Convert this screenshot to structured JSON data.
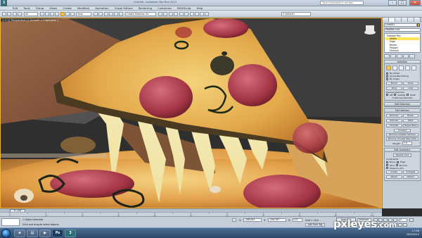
{
  "window": {
    "title": "Untitled - Autodesk 3ds Max 2012",
    "search_placeholder": "Type a keyword or phrase",
    "minimize": "–",
    "maximize": "□",
    "close": "✕"
  },
  "menu": [
    "Edit",
    "Tools",
    "Group",
    "Views",
    "Create",
    "Modifiers",
    "Animation",
    "Graph Editors",
    "Rendering",
    "Customize",
    "MAXScript",
    "Help"
  ],
  "toolbar": {
    "filter_value": "All",
    "refcoord_value": "View",
    "named_sel_placeholder": "Create Selection Se",
    "layer_value": "0 (default)"
  },
  "viewport": {
    "label": "[ + ] [ Perspective ] [ Smooth + Highlights ]"
  },
  "command_panel": {
    "object_name": "Line001",
    "modifier_list": "Modifier List",
    "stack": [
      {
        "label": "Editable Poly",
        "selected": false,
        "sub": false
      },
      {
        "label": "Vertex",
        "selected": true,
        "sub": true
      },
      {
        "label": "Edge",
        "selected": false,
        "sub": true
      },
      {
        "label": "Border",
        "selected": false,
        "sub": true
      },
      {
        "label": "Polygon",
        "selected": false,
        "sub": true
      },
      {
        "label": "Element",
        "selected": false,
        "sub": true
      }
    ],
    "selection_rollout": {
      "title": "Selection",
      "by_vertex": "By Vertex",
      "ignore_backfacing": "Ignore Backfacing",
      "by_angle": "By Angle:",
      "shrink": "Shrink",
      "grow": "Grow",
      "ring": "Ring",
      "loop": "Loop",
      "preview_selection": "Preview Selection",
      "off": "Off",
      "subobj": "SubObj",
      "multi": "Multi",
      "status": "0 Vertices Selected"
    },
    "soft_selection": {
      "title": "Soft Selection"
    },
    "edit_vertices": {
      "title": "Edit Vertices",
      "remove": "Remove",
      "break": "Break",
      "extrude": "Extrude",
      "weld": "Weld",
      "chamfer": "Chamfer",
      "target_weld": "Target Weld",
      "connect": "Connect",
      "remove_isolated": "Remove Isolated Vertices",
      "remove_unused": "Remove Unused Map Verts",
      "weight": "Weight:",
      "weight_value": "1,0"
    },
    "edit_geometry": {
      "title": "Edit Geometry",
      "repeat_last": "Repeat Last",
      "constraints": "Constraints",
      "none": "None",
      "edge": "Edge",
      "face": "Face",
      "normal": "Normal",
      "preserve_uvs": "Preserve UVs",
      "create": "Create",
      "collapse": "Collapse",
      "attach": "Attach",
      "detach": "Detach"
    }
  },
  "timeline": {
    "thumb": "0 / 100",
    "ticks": [
      "0",
      "10",
      "20",
      "30",
      "40",
      "50",
      "60",
      "70",
      "80",
      "90",
      "100"
    ]
  },
  "status": {
    "listener": "",
    "selection_info": "1 Object Selected",
    "prompt": "Click and drag to select objects",
    "x_label": "X:",
    "x_value": "-198,003",
    "y_label": "Y:",
    "y_value": "-206,787",
    "z_label": "Z:",
    "z_value": "0,0",
    "grid": "Grid = 10,0",
    "auto_key": "Auto Key",
    "set_key": "Set Key",
    "selected": "Selected",
    "key_filters": "Key Filters...",
    "add_time_tag": "Add Time Tag",
    "frame": "0"
  },
  "taskbar": {
    "apps": [
      "e",
      "▤",
      "▶",
      "Ps",
      "3"
    ],
    "time": "17:58",
    "date": "29/5/2012"
  },
  "watermark": {
    "main": "pxleyes",
    "suffix": ".com"
  }
}
